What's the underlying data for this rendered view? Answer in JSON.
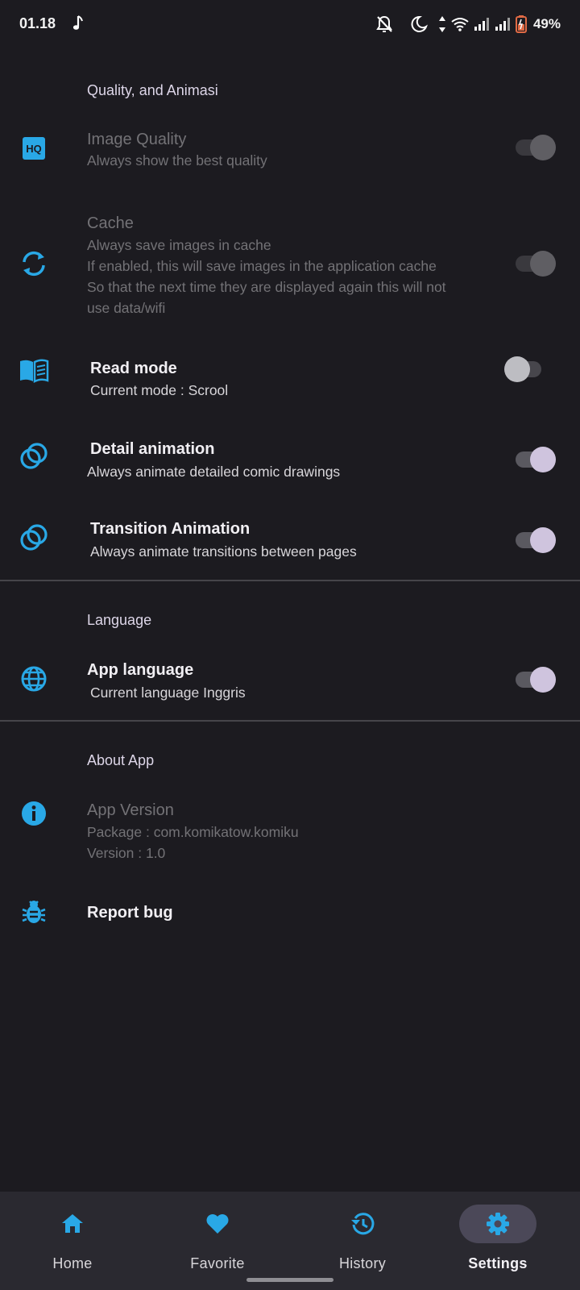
{
  "status_bar": {
    "time": "01.18",
    "battery": "49%"
  },
  "colors": {
    "accent": "#29a8e6",
    "background": "#1c1b20",
    "switch_on_thumb": "#cfc4de"
  },
  "sections": {
    "quality": {
      "title": "Quality, and Animasi"
    },
    "language": {
      "title": "Language"
    },
    "about": {
      "title": "About App"
    }
  },
  "settings": {
    "image_quality": {
      "icon": "hq-icon",
      "title": "Image Quality",
      "sub": "Always show the best quality",
      "enabled": false,
      "checked": true
    },
    "cache": {
      "icon": "sync-icon",
      "title": "Cache",
      "lines": [
        "Always save images in cache",
        "If enabled, this will save images in the application cache",
        "So that the next time they are displayed again this will not",
        "use data/wifi"
      ],
      "enabled": false,
      "checked": true
    },
    "read_mode": {
      "icon": "book-icon",
      "title": "Read mode",
      "sub": "Current mode : Scrool",
      "checked": false
    },
    "detail_animation": {
      "icon": "rings-icon",
      "title": "Detail animation",
      "sub": "Always animate detailed comic drawings",
      "checked": true
    },
    "transition_animation": {
      "icon": "rings-icon",
      "title": "Transition Animation",
      "sub": "Always animate transitions between pages",
      "checked": true
    },
    "app_language": {
      "icon": "globe-icon",
      "title": "App language",
      "sub": "Current language Inggris",
      "checked": true
    },
    "app_version": {
      "icon": "info-icon",
      "title": "App Version",
      "package": "Package : com.komikatow.komiku",
      "version": "Version : 1.0"
    },
    "report_bug": {
      "icon": "bug-icon",
      "title": "Report bug"
    }
  },
  "bottom_nav": {
    "items": [
      {
        "label": "Home",
        "icon": "home-icon",
        "active": false
      },
      {
        "label": "Favorite",
        "icon": "heart-icon",
        "active": false
      },
      {
        "label": "History",
        "icon": "history-icon",
        "active": false
      },
      {
        "label": "Settings",
        "icon": "gear-icon",
        "active": true
      }
    ]
  }
}
